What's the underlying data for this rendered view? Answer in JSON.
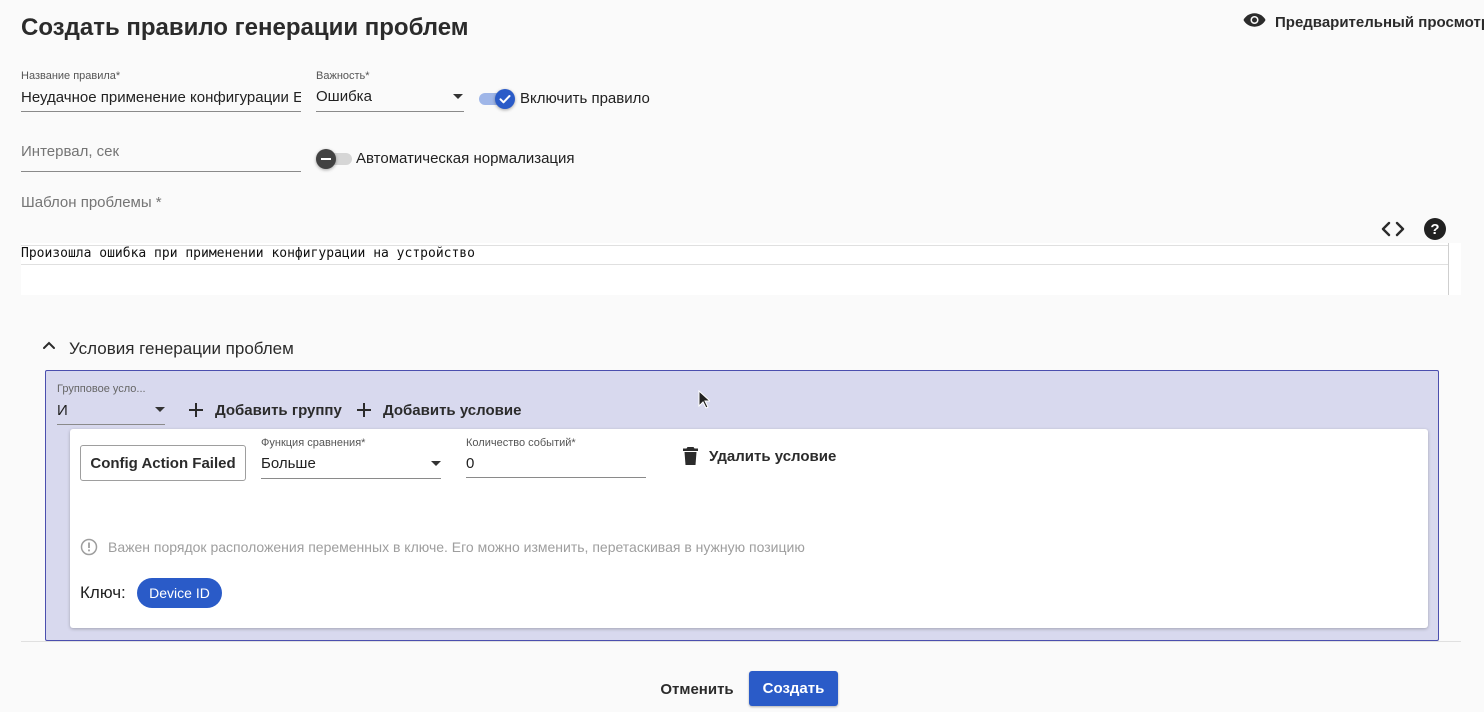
{
  "page": {
    "title": "Создать правило генерации проблем"
  },
  "header": {
    "preview_label": "Предварительный просмотр"
  },
  "form": {
    "rule_name": {
      "label": "Название правила*",
      "value": "Неудачное применение конфигурации Е"
    },
    "severity": {
      "label": "Важность*",
      "value": "Ошибка"
    },
    "enable_rule": {
      "label": "Включить правило",
      "checked": true
    },
    "interval": {
      "placeholder": "Интервал, сек"
    },
    "auto_normalization": {
      "label": "Автоматическая нормализация",
      "checked": false
    },
    "template": {
      "label": "Шаблон проблемы *",
      "value": "Произошла ошибка при применении конфигурации на устройство",
      "code_icon": "code-icon",
      "help_icon": "help-icon"
    }
  },
  "conditions": {
    "section_title": "Условия генерации проблем",
    "group": {
      "condition_label": "Групповое усло...",
      "condition_value": "И",
      "add_group_label": "Добавить группу",
      "add_condition_label": "Добавить условие"
    },
    "condition": {
      "event_button_label": "Config Action Failed",
      "comparison": {
        "label": "Функция сравнения*",
        "value": "Больше"
      },
      "event_count": {
        "label": "Количество событий*",
        "value": "0"
      },
      "delete_label": "Удалить условие",
      "hint": "Важен порядок расположения переменных в ключе. Его можно изменить, перетаскивая в нужную позицию",
      "key_label": "Ключ:",
      "key_chips": [
        "Device ID"
      ]
    }
  },
  "footer": {
    "cancel_label": "Отменить",
    "create_label": "Создать"
  },
  "colors": {
    "primary": "#2a5bc8",
    "group_bg": "#d8d9ee",
    "group_border": "#4b4fae"
  }
}
